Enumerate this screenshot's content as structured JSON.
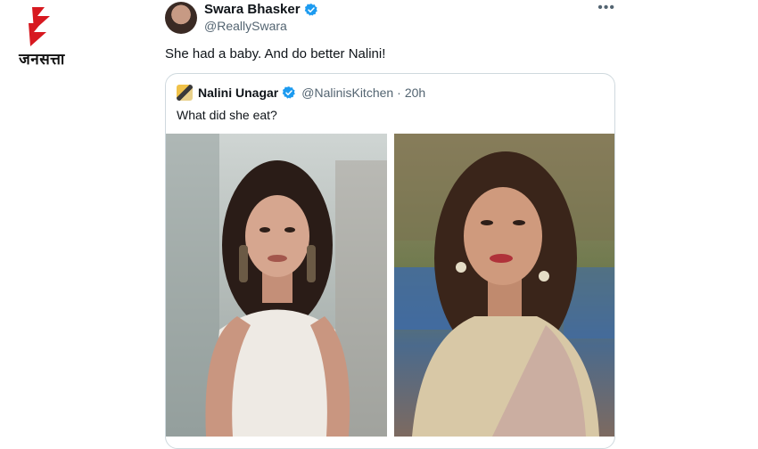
{
  "publisher": {
    "logo_text": "जनसत्ता"
  },
  "tweet": {
    "display_name": "Swara Bhasker",
    "handle": "@ReallySwara",
    "text": "She had a baby. And do better Nalini!",
    "more_icon": "more-dots-icon",
    "verified_color": "#1d9bf0"
  },
  "quoted_tweet": {
    "display_name": "Nalini Unagar",
    "handle": "@NalinisKitchen",
    "separator": "·",
    "time": "20h",
    "text": "What did she eat?",
    "photos": [
      "photo-left",
      "photo-right"
    ]
  },
  "colors": {
    "logo_red": "#d71920",
    "verified": "#1d9bf0",
    "secondary_text": "#536471"
  }
}
